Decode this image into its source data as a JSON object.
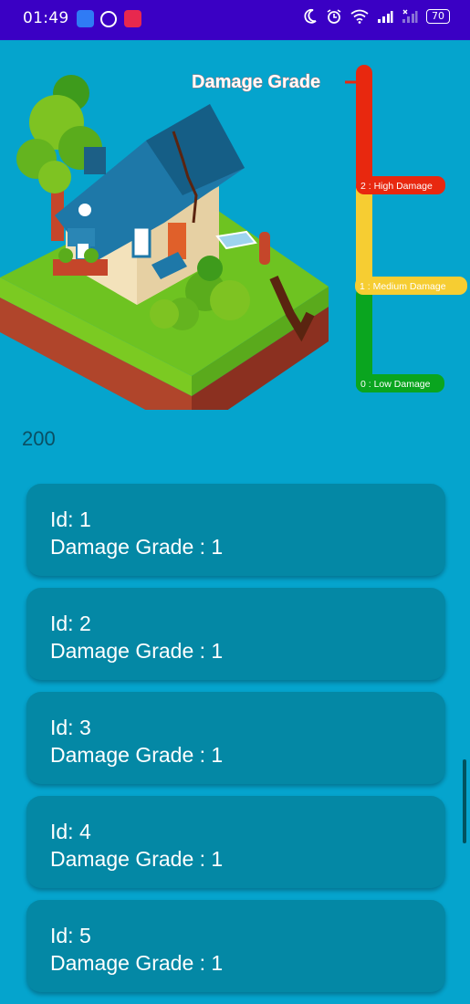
{
  "status_bar": {
    "time": "01:49",
    "battery": "70"
  },
  "header": {
    "title": "Damage Grade",
    "legend": [
      {
        "label": "2 : High Damage",
        "color": "#e8280f"
      },
      {
        "label": "1 : Medium Damage",
        "color": "#f6cd32"
      },
      {
        "label": "0 : Low Damage",
        "color": "#0aa51f"
      }
    ]
  },
  "count": "200",
  "items": [
    {
      "id": "Id: 1",
      "grade": "Damage Grade : 1"
    },
    {
      "id": "Id: 2",
      "grade": "Damage Grade : 1"
    },
    {
      "id": "Id: 3",
      "grade": "Damage Grade : 1"
    },
    {
      "id": "Id: 4",
      "grade": "Damage Grade : 1"
    },
    {
      "id": "Id: 5",
      "grade": "Damage Grade : 1"
    }
  ]
}
